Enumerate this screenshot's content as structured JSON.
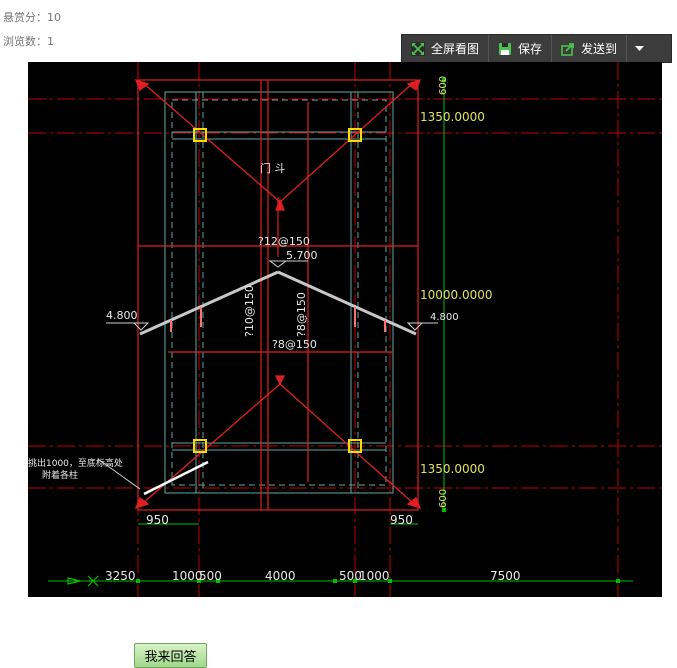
{
  "meta": {
    "reward": "悬赏分：10",
    "views": "浏览数：1"
  },
  "toolbar": {
    "fullscreen": "全屏看图",
    "save": "保存",
    "send_to": "发送到"
  },
  "drawing": {
    "title": "门  斗",
    "rebar_top": "?12@150",
    "elev_top": "5.700",
    "elev_left": "4.800",
    "elev_right": "4.800",
    "rebar_v1": "?10@150",
    "rebar_v2": "?8@150",
    "rebar_bottom": "?8@150",
    "dim_600_top": "600",
    "dim_1350_top": "1350.0000",
    "dim_10000": "10000.0000",
    "dim_1350_bottom": "1350.0000",
    "dim_600_bottom": "600",
    "dim_950_left": "950",
    "dim_950_right": "950",
    "note_line1": "挑出1000，至底标高处",
    "note_line2": "附着各柱",
    "bottom_dims": [
      "3250",
      "1000",
      "500",
      "4000",
      "500",
      "1000",
      "7500"
    ]
  },
  "actions": {
    "answer": "我来回答"
  }
}
